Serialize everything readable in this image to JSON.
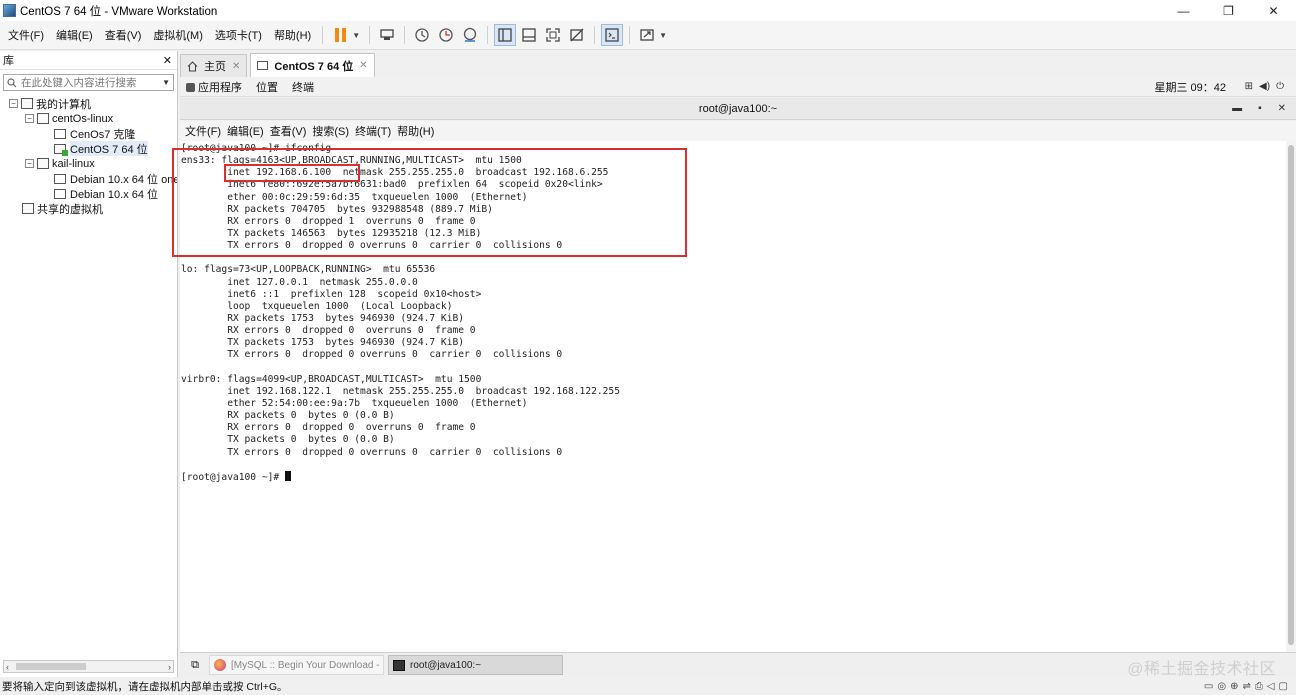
{
  "window": {
    "title": "CentOS 7 64 位 - VMware Workstation",
    "minimize": "—",
    "maximize": "❐",
    "close": "✕"
  },
  "menubar": {
    "items": [
      "文件(F)",
      "编辑(E)",
      "查看(V)",
      "虚拟机(M)",
      "选项卡(T)",
      "帮助(H)"
    ]
  },
  "library": {
    "title": "库",
    "close": "✕",
    "search_placeholder": "在此处键入内容进行搜索",
    "tree": {
      "my_computer": "我的计算机",
      "group1": "centOs-linux",
      "vm1": "CenOs7 克隆",
      "vm2": "CentOS 7 64 位",
      "group2": "kail-linux",
      "vm3": "Debian 10.x 64 位 one",
      "vm4": "Debian 10.x 64 位",
      "shared": "共享的虚拟机"
    }
  },
  "tabs": {
    "home": "主页",
    "vm": "CentOS 7 64 位"
  },
  "gnome": {
    "apps": "应用程序",
    "places": "位置",
    "terminal": "终端",
    "clock": "星期三 09：42"
  },
  "terminal": {
    "title": "root@java100:~",
    "menu": [
      "文件(F)",
      "编辑(E)",
      "查看(V)",
      "搜索(S)",
      "终端(T)",
      "帮助(H)"
    ],
    "lines": [
      "[root@java100 ~]# ifconfig",
      "ens33: flags=4163<UP,BROADCAST,RUNNING,MULTICAST>  mtu 1500",
      "        inet 192.168.6.100  netmask 255.255.255.0  broadcast 192.168.6.255",
      "        inet6 fe80::692e:5a7b:6631:bad0  prefixlen 64  scopeid 0x20<link>",
      "        ether 00:0c:29:59:6d:35  txqueuelen 1000  (Ethernet)",
      "        RX packets 704705  bytes 932988548 (889.7 MiB)",
      "        RX errors 0  dropped 1  overruns 0  frame 0",
      "        TX packets 146563  bytes 12935218 (12.3 MiB)",
      "        TX errors 0  dropped 0 overruns 0  carrier 0  collisions 0",
      "",
      "lo: flags=73<UP,LOOPBACK,RUNNING>  mtu 65536",
      "        inet 127.0.0.1  netmask 255.0.0.0",
      "        inet6 ::1  prefixlen 128  scopeid 0x10<host>",
      "        loop  txqueuelen 1000  (Local Loopback)",
      "        RX packets 1753  bytes 946930 (924.7 KiB)",
      "        RX errors 0  dropped 0  overruns 0  frame 0",
      "        TX packets 1753  bytes 946930 (924.7 KiB)",
      "        TX errors 0  dropped 0 overruns 0  carrier 0  collisions 0",
      "",
      "virbr0: flags=4099<UP,BROADCAST,MULTICAST>  mtu 1500",
      "        inet 192.168.122.1  netmask 255.255.255.0  broadcast 192.168.122.255",
      "        ether 52:54:00:ee:9a:7b  txqueuelen 1000  (Ethernet)",
      "        RX packets 0  bytes 0 (0.0 B)",
      "        RX errors 0  dropped 0  overruns 0  frame 0",
      "        TX packets 0  bytes 0 (0.0 B)",
      "        TX errors 0  dropped 0 overruns 0  carrier 0  collisions 0",
      "",
      "[root@java100 ~]# "
    ]
  },
  "taskbar": {
    "task1": "[MySQL :: Begin Your Download - ...",
    "task2": "root@java100:~"
  },
  "watermark": "@稀土掘金技术社区",
  "statusbar": {
    "text": "要将输入定向到该虚拟机，请在虚拟机内部单击或按 Ctrl+G。"
  },
  "colors": {
    "highlight": "#d9302e",
    "pause": "#f08a14"
  }
}
